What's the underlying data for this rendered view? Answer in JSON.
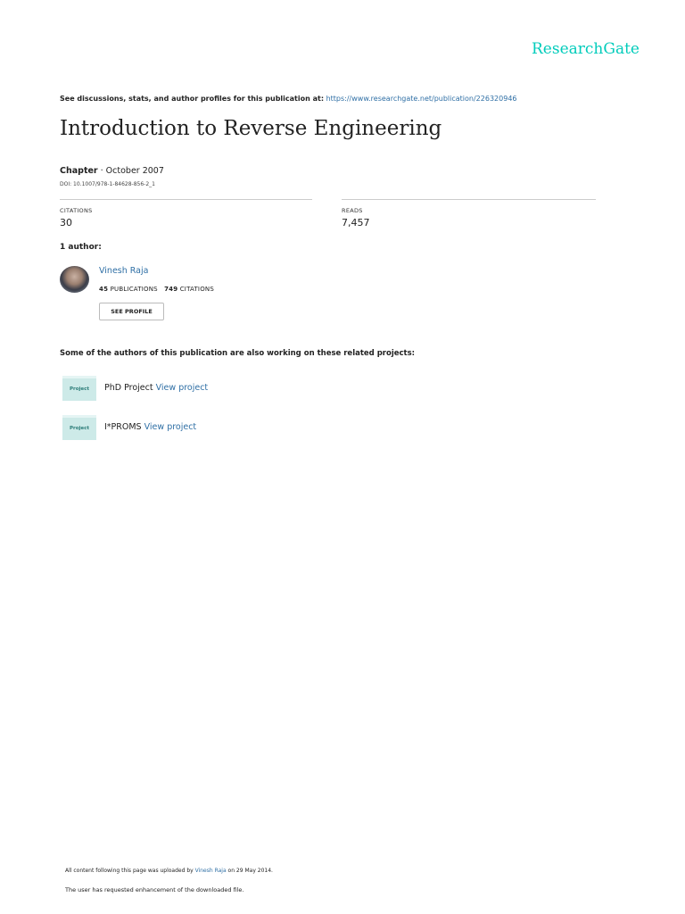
{
  "logo": "ResearchGate",
  "header": {
    "see_text": "See discussions, stats, and author profiles for this publication at:",
    "url": "https://www.researchgate.net/publication/226320946"
  },
  "title": "Introduction to Reverse Engineering",
  "meta": {
    "type": "Chapter",
    "date": " · October 2007",
    "doi": "DOI: 10.1007/978-1-84628-856-2_1"
  },
  "stats": {
    "citations_label": "CITATIONS",
    "citations": "30",
    "reads_label": "READS",
    "reads": "7,457"
  },
  "authors_heading": "1 author:",
  "author": {
    "name": "Vinesh Raja",
    "publications": "45",
    "publications_label": "PUBLICATIONS",
    "citations": "749",
    "citations_label": "CITATIONS",
    "see_profile": "SEE PROFILE"
  },
  "related_heading": "Some of the authors of this publication are also working on these related projects:",
  "projects": [
    {
      "icon_label": "Project",
      "name": "PhD Project",
      "link": "View project"
    },
    {
      "icon_label": "Project",
      "name": "I*PROMS",
      "link": "View project"
    }
  ],
  "footer": {
    "uploaded_prefix": "All content following this page was uploaded by",
    "uploader": "Vinesh Raja",
    "uploaded_suffix": "on 29 May 2014.",
    "note": "The user has requested enhancement of the downloaded file."
  }
}
